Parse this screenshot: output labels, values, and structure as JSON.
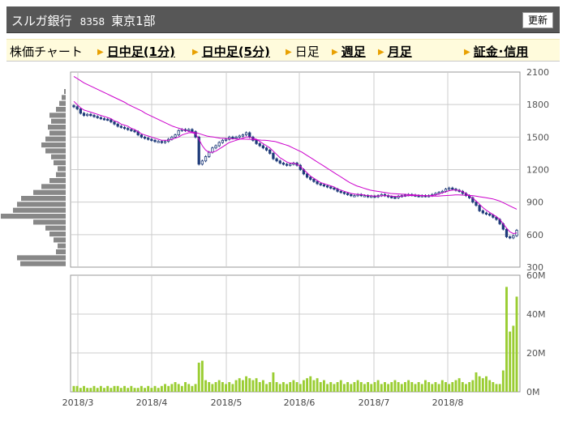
{
  "header": {
    "company": "スルガ銀行",
    "code": "8358",
    "market": "東京1部",
    "refresh_label": "更新"
  },
  "tabs": [
    {
      "label": "株価チャート",
      "link": false
    },
    {
      "label": "日中足(1分)",
      "link": true
    },
    {
      "label": "日中足(5分)",
      "link": true
    },
    {
      "label": "日足",
      "link": false
    },
    {
      "label": "週足",
      "link": true
    },
    {
      "label": "月足",
      "link": true
    },
    {
      "label": "証金･信用",
      "link": true
    }
  ],
  "colors": {
    "candle": "#1f3b7a",
    "ma": "#cc00cc",
    "volume": "#9acd32",
    "profile": "#888888",
    "grid": "#cccccc"
  },
  "chart_data": {
    "type": "candlestick",
    "x_tick_labels": [
      "2018/3",
      "2018/4",
      "2018/5",
      "2018/6",
      "2018/7",
      "2018/8"
    ],
    "price_axis": {
      "ticks": [
        2100,
        1800,
        1500,
        1200,
        900,
        600,
        300
      ],
      "ylim": [
        300,
        2100
      ]
    },
    "volume_axis": {
      "ticks": [
        "60M",
        "40M",
        "20M",
        "0M"
      ],
      "ylim": [
        0,
        60
      ]
    },
    "close": [
      1780,
      1760,
      1720,
      1700,
      1710,
      1700,
      1690,
      1680,
      1670,
      1665,
      1660,
      1640,
      1620,
      1600,
      1590,
      1580,
      1570,
      1560,
      1550,
      1520,
      1500,
      1490,
      1480,
      1470,
      1460,
      1460,
      1450,
      1460,
      1480,
      1500,
      1520,
      1560,
      1570,
      1560,
      1570,
      1550,
      1500,
      1250,
      1280,
      1320,
      1360,
      1400,
      1420,
      1450,
      1470,
      1480,
      1500,
      1490,
      1500,
      1510,
      1520,
      1540,
      1500,
      1470,
      1440,
      1420,
      1400,
      1380,
      1350,
      1300,
      1280,
      1260,
      1250,
      1240,
      1250,
      1260,
      1240,
      1200,
      1160,
      1130,
      1110,
      1090,
      1070,
      1060,
      1050,
      1040,
      1030,
      1020,
      1000,
      990,
      980,
      970,
      960,
      960,
      970,
      960,
      960,
      950,
      955,
      950,
      960,
      970,
      960,
      950,
      945,
      940,
      955,
      960,
      965,
      970,
      965,
      960,
      955,
      960,
      955,
      960,
      970,
      980,
      990,
      1000,
      1020,
      1030,
      1020,
      1010,
      1000,
      980,
      960,
      940,
      900,
      870,
      820,
      800,
      790,
      780,
      760,
      740,
      700,
      650,
      580,
      570,
      590,
      640
    ],
    "ma_fast": [
      1830,
      1800,
      1770,
      1750,
      1740,
      1730,
      1720,
      1710,
      1700,
      1690,
      1680,
      1670,
      1650,
      1640,
      1620,
      1610,
      1600,
      1580,
      1570,
      1550,
      1530,
      1520,
      1510,
      1500,
      1490,
      1480,
      1470,
      1470,
      1470,
      1480,
      1490,
      1500,
      1520,
      1530,
      1540,
      1540,
      1530,
      1480,
      1420,
      1380,
      1360,
      1360,
      1370,
      1390,
      1410,
      1430,
      1450,
      1460,
      1470,
      1480,
      1490,
      1500,
      1500,
      1490,
      1480,
      1460,
      1440,
      1420,
      1400,
      1370,
      1340,
      1310,
      1290,
      1270,
      1260,
      1260,
      1250,
      1230,
      1200,
      1170,
      1140,
      1120,
      1100,
      1080,
      1070,
      1060,
      1050,
      1040,
      1020,
      1010,
      1000,
      990,
      980,
      975,
      970,
      970,
      965,
      960,
      958,
      955,
      955,
      958,
      960,
      958,
      955,
      952,
      952,
      955,
      958,
      960,
      962,
      960,
      960,
      958,
      958,
      958,
      962,
      968,
      975,
      985,
      995,
      1005,
      1012,
      1012,
      1008,
      995,
      980,
      960,
      935,
      910,
      880,
      850,
      825,
      805,
      785,
      765,
      740,
      700,
      660,
      625,
      610,
      615
    ],
    "ma_slow": [
      2060,
      2040,
      2020,
      2000,
      1985,
      1970,
      1955,
      1940,
      1925,
      1910,
      1895,
      1880,
      1865,
      1850,
      1835,
      1820,
      1800,
      1785,
      1770,
      1755,
      1740,
      1720,
      1705,
      1690,
      1675,
      1660,
      1645,
      1630,
      1615,
      1600,
      1590,
      1580,
      1570,
      1560,
      1550,
      1545,
      1540,
      1530,
      1520,
      1510,
      1505,
      1500,
      1495,
      1490,
      1488,
      1486,
      1485,
      1484,
      1483,
      1482,
      1481,
      1480,
      1478,
      1476,
      1474,
      1472,
      1470,
      1468,
      1464,
      1460,
      1450,
      1440,
      1430,
      1420,
      1405,
      1390,
      1375,
      1360,
      1340,
      1320,
      1300,
      1280,
      1260,
      1240,
      1220,
      1200,
      1180,
      1160,
      1140,
      1120,
      1100,
      1080,
      1065,
      1050,
      1040,
      1030,
      1020,
      1010,
      1005,
      1000,
      995,
      990,
      985,
      980,
      978,
      976,
      974,
      972,
      970,
      968,
      966,
      964,
      962,
      960,
      958,
      956,
      955,
      956,
      958,
      960,
      962,
      964,
      966,
      966,
      965,
      964,
      962,
      960,
      955,
      950,
      945,
      940,
      935,
      930,
      920,
      910,
      895,
      880,
      865,
      850,
      835
    ],
    "volume": [
      3,
      3,
      2,
      3,
      2,
      2,
      3,
      2,
      3,
      2,
      3,
      2,
      3,
      3,
      2,
      3,
      2,
      3,
      2,
      2,
      3,
      2,
      3,
      2,
      3,
      2,
      3,
      4,
      3,
      4,
      5,
      4,
      3,
      5,
      4,
      3,
      4,
      15,
      16,
      6,
      5,
      4,
      5,
      6,
      5,
      4,
      5,
      4,
      6,
      7,
      6,
      8,
      7,
      6,
      7,
      5,
      6,
      4,
      5,
      10,
      5,
      4,
      5,
      4,
      5,
      6,
      5,
      4,
      6,
      7,
      8,
      6,
      7,
      5,
      6,
      4,
      5,
      4,
      5,
      6,
      4,
      5,
      4,
      5,
      6,
      5,
      4,
      5,
      4,
      5,
      6,
      4,
      5,
      4,
      5,
      6,
      5,
      4,
      5,
      6,
      5,
      4,
      5,
      4,
      6,
      5,
      4,
      5,
      4,
      6,
      5,
      4,
      5,
      6,
      7,
      5,
      4,
      5,
      6,
      10,
      8,
      7,
      8,
      6,
      5,
      4,
      4,
      11,
      54,
      31,
      34,
      49
    ],
    "price_profile": [
      2,
      5,
      8,
      12,
      20,
      18,
      22,
      20,
      25,
      30,
      25,
      18,
      15,
      10,
      12,
      20,
      30,
      40,
      55,
      60,
      65,
      80,
      40,
      25,
      20,
      15,
      10,
      12,
      60,
      56
    ]
  }
}
